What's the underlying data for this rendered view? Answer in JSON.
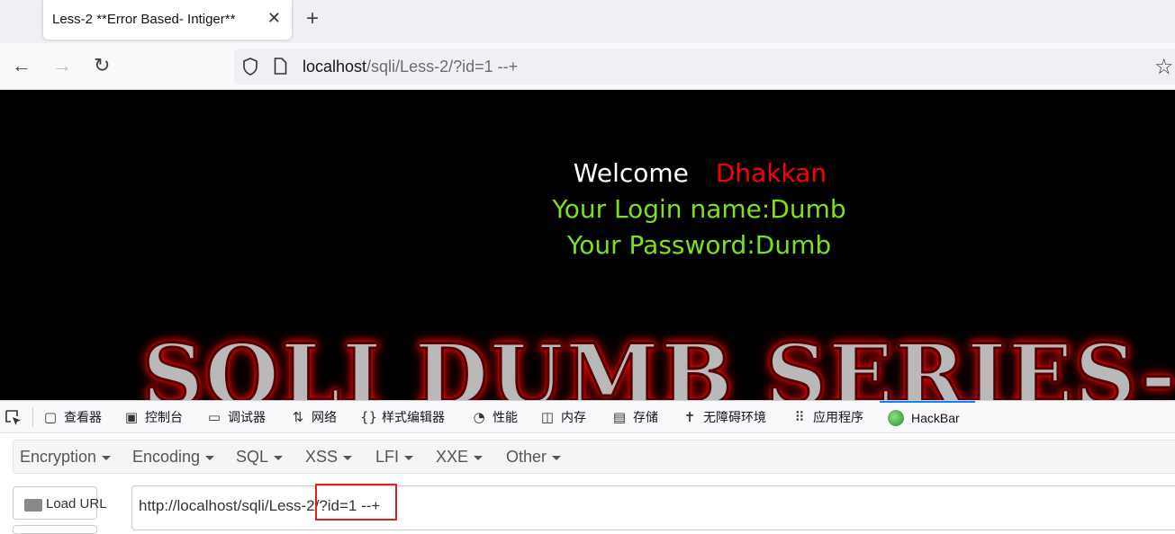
{
  "tab": {
    "title": "Less-2 **Error Based- Intiger**",
    "close": "✕",
    "new_tab": "+"
  },
  "nav": {
    "back": "←",
    "forward": "→",
    "reload": "↻",
    "url_host": "localhost",
    "url_path": "/sqli/Less-2/?id=1 --+",
    "star": "☆"
  },
  "page": {
    "welcome": "Welcome",
    "welcome_name": "Dhakkan",
    "login_name": "Your Login name:Dumb",
    "password": "Your Password:Dumb",
    "banner": "SQLI DUMB SERIES-"
  },
  "devtools": {
    "tabs": [
      {
        "label": "查看器",
        "icon": "inspector-icon",
        "glyph": "▢"
      },
      {
        "label": "控制台",
        "icon": "console-icon",
        "glyph": "▣"
      },
      {
        "label": "调试器",
        "icon": "debugger-icon",
        "glyph": "▭"
      },
      {
        "label": "网络",
        "icon": "network-icon",
        "glyph": "⇅"
      },
      {
        "label": "样式编辑器",
        "icon": "style-editor-icon",
        "glyph": "{}"
      },
      {
        "label": "性能",
        "icon": "performance-icon",
        "glyph": "◔"
      },
      {
        "label": "内存",
        "icon": "memory-icon",
        "glyph": "◫"
      },
      {
        "label": "存储",
        "icon": "storage-icon",
        "glyph": "▤"
      },
      {
        "label": "无障碍环境",
        "icon": "accessibility-icon",
        "glyph": "✝"
      },
      {
        "label": "应用程序",
        "icon": "application-icon",
        "glyph": "⠿"
      },
      {
        "label": "HackBar",
        "icon": "hackbar-icon",
        "glyph": ""
      }
    ]
  },
  "hackbar": {
    "menu": [
      "Encryption",
      "Encoding",
      "SQL",
      "XSS",
      "LFI",
      "XXE",
      "Other"
    ],
    "load_url": "Load URL",
    "url_value": "http://localhost/sqli/Less-2/?id=1 --+"
  }
}
